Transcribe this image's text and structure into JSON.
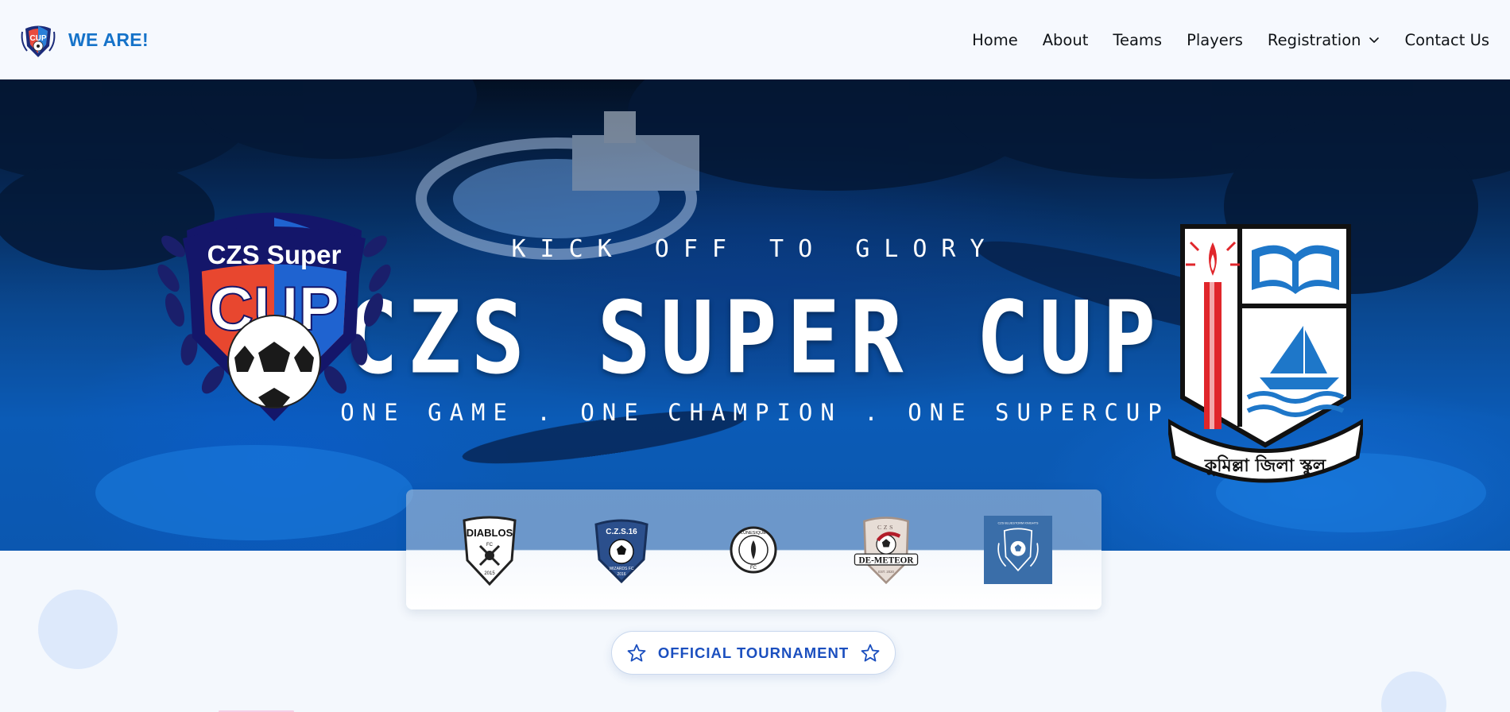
{
  "header": {
    "brand_text": "WE ARE!",
    "logo_label": "CUP",
    "nav": [
      {
        "label": "Home"
      },
      {
        "label": "About"
      },
      {
        "label": "Teams"
      },
      {
        "label": "Players"
      },
      {
        "label": "Registration",
        "has_dropdown": true
      },
      {
        "label": "Contact Us"
      }
    ]
  },
  "hero": {
    "kicker": "KICK OFF TO GLORY",
    "title": "CZS SUPER CUP",
    "tagline": "ONE GAME . ONE CHAMPION . ONE SUPERCUP",
    "left_emblem": {
      "line1": "CZS Super",
      "line2": "CUP"
    },
    "right_emblem": {
      "banner_text": "কুমিল্লা জিলা স্কুল"
    }
  },
  "teams": [
    {
      "name": "DIABLOS",
      "sub": "FC",
      "year": "2015"
    },
    {
      "name": "C.Z.S.16",
      "sub": "WIZARDS FC",
      "year": "2016"
    },
    {
      "name": "LUNESIQUE",
      "sub": "FC",
      "year": ""
    },
    {
      "name": "DE-METEOR",
      "sub": "CZS",
      "year": "EST. 2020"
    },
    {
      "name": "CZS BLUESTORM KNIGHTS",
      "sub": "",
      "year": ""
    }
  ],
  "badge": {
    "label": "OFFICIAL TOURNAMENT",
    "icon": "star-icon"
  },
  "colors": {
    "brand": "#1673c9",
    "hero_blue": "#0c63c6",
    "badge_text": "#1b4fbf"
  }
}
